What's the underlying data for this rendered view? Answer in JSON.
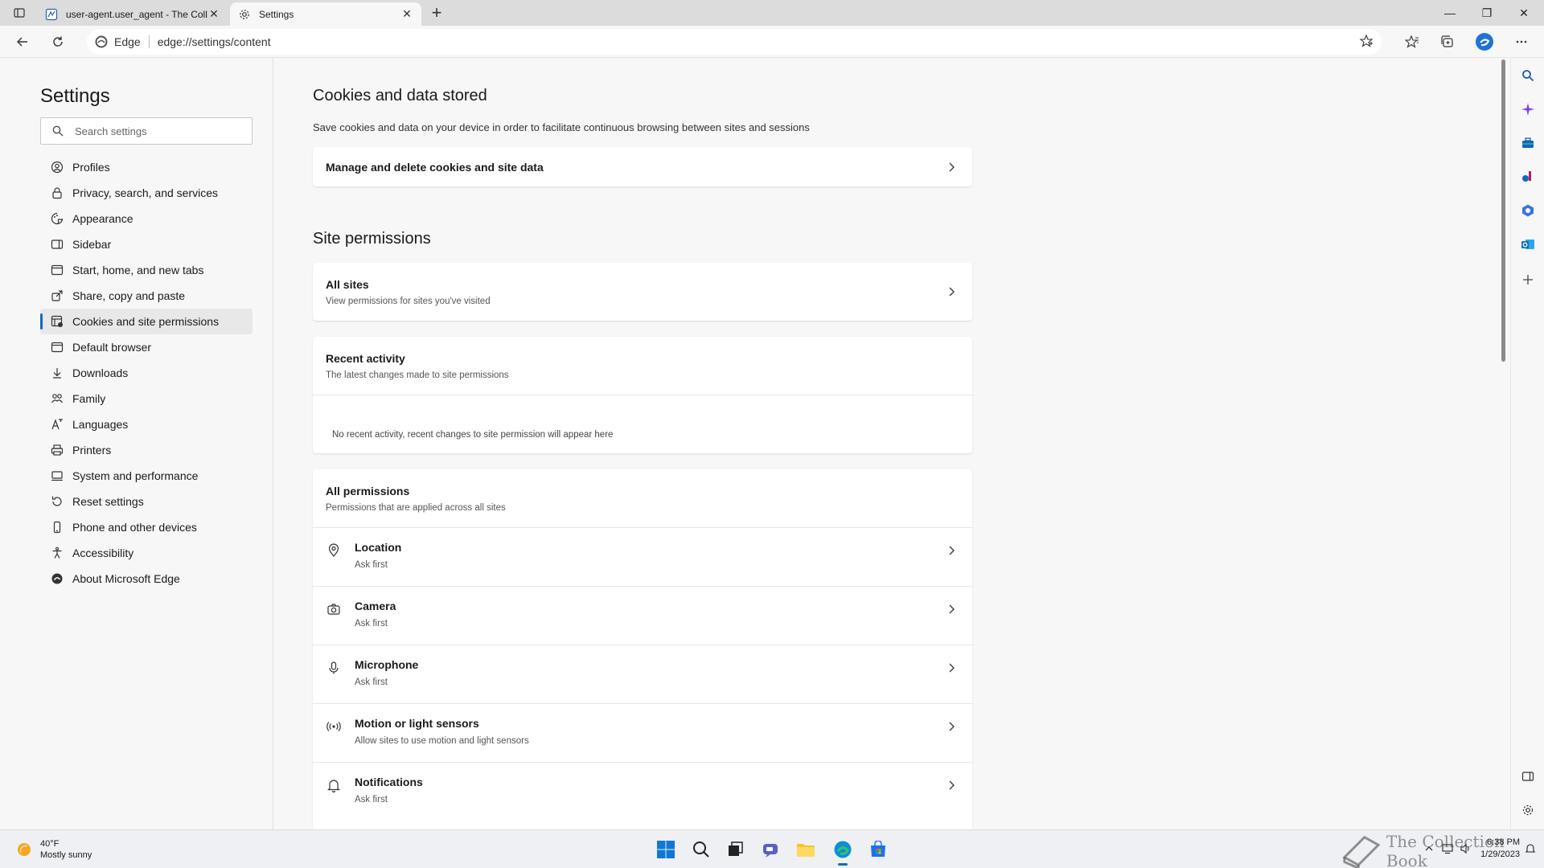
{
  "tabs": [
    {
      "title": "user-agent.user_agent - The Coll",
      "close": "✕"
    },
    {
      "title": "Settings",
      "close": "✕"
    }
  ],
  "window": {
    "new_tab": "+",
    "minimize": "—",
    "restore": "❐",
    "close": "✕"
  },
  "address": {
    "site_label": "Edge",
    "url": "edge://settings/content"
  },
  "nav": {
    "title": "Settings",
    "search_placeholder": "Search settings",
    "items": [
      {
        "label": "Profiles",
        "icon": "profile-icon"
      },
      {
        "label": "Privacy, search, and services",
        "icon": "lock-icon"
      },
      {
        "label": "Appearance",
        "icon": "appearance-icon"
      },
      {
        "label": "Sidebar",
        "icon": "sidebar-icon"
      },
      {
        "label": "Start, home, and new tabs",
        "icon": "home-icon"
      },
      {
        "label": "Share, copy and paste",
        "icon": "share-icon"
      },
      {
        "label": "Cookies and site permissions",
        "icon": "cookies-icon",
        "active": true
      },
      {
        "label": "Default browser",
        "icon": "browser-icon"
      },
      {
        "label": "Downloads",
        "icon": "download-icon"
      },
      {
        "label": "Family",
        "icon": "family-icon"
      },
      {
        "label": "Languages",
        "icon": "language-icon"
      },
      {
        "label": "Printers",
        "icon": "printer-icon"
      },
      {
        "label": "System and performance",
        "icon": "system-icon"
      },
      {
        "label": "Reset settings",
        "icon": "reset-icon"
      },
      {
        "label": "Phone and other devices",
        "icon": "phone-icon"
      },
      {
        "label": "Accessibility",
        "icon": "accessibility-icon"
      },
      {
        "label": "About Microsoft Edge",
        "icon": "edge-icon"
      }
    ]
  },
  "cookies": {
    "title": "Cookies and data stored",
    "description": "Save cookies and data on your device in order to facilitate continuous browsing between sites and sessions",
    "manage_label": "Manage and delete cookies and site data"
  },
  "site_permissions": {
    "title": "Site permissions",
    "all_sites": {
      "title": "All sites",
      "subtitle": "View permissions for sites you've visited"
    },
    "recent_activity": {
      "title": "Recent activity",
      "subtitle": "The latest changes made to site permissions",
      "empty": "No recent activity, recent changes to site permission will appear here"
    },
    "all_permissions": {
      "title": "All permissions",
      "subtitle": "Permissions that are applied across all sites",
      "items": [
        {
          "title": "Location",
          "subtitle": "Ask first",
          "icon": "location-icon"
        },
        {
          "title": "Camera",
          "subtitle": "Ask first",
          "icon": "camera-icon"
        },
        {
          "title": "Microphone",
          "subtitle": "Ask first",
          "icon": "microphone-icon"
        },
        {
          "title": "Motion or light sensors",
          "subtitle": "Allow sites to use motion and light sensors",
          "icon": "sensor-icon"
        },
        {
          "title": "Notifications",
          "subtitle": "Ask first",
          "icon": "bell-icon"
        }
      ]
    }
  },
  "taskbar": {
    "weather_temp": "40°F",
    "weather_desc": "Mostly sunny",
    "time": "6:38 PM",
    "date": "1/29/2023",
    "watermark": "The Collection Book"
  },
  "colors": {
    "accent": "#0f6cbd",
    "active_bg": "#e8e8e8"
  }
}
